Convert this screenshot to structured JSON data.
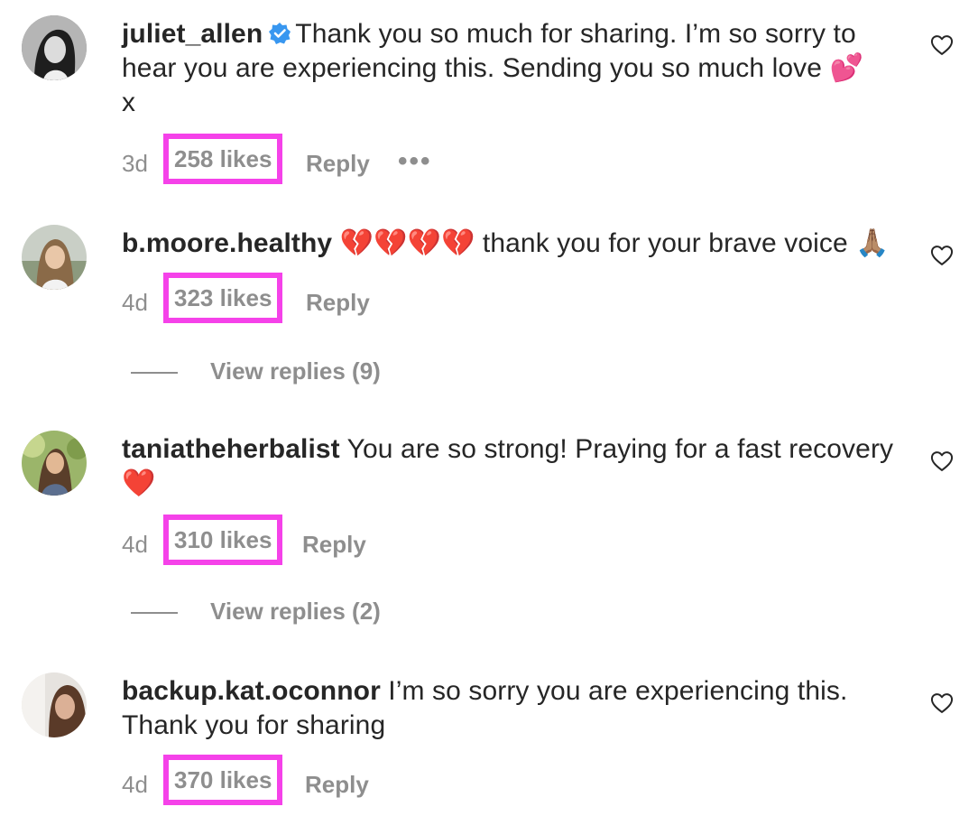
{
  "comments": [
    {
      "username": "juliet_allen",
      "verified": true,
      "text": "Thank you so much for sharing. I’m so sorry to hear you are experiencing this. Sending you so much love",
      "emoji": "💕",
      "text_tail": "x",
      "time": "3d",
      "likes": "258 likes",
      "reply": "Reply",
      "more": "•••"
    },
    {
      "username": "b.moore.healthy",
      "verified": false,
      "emoji_prefix": "💔💔💔💔",
      "text": "thank you for your brave voice",
      "emoji": "🙏🏽",
      "time": "4d",
      "likes": "323 likes",
      "reply": "Reply",
      "view_replies": "View replies (9)"
    },
    {
      "username": "taniatheherbalist",
      "verified": false,
      "text": "You are so strong! Praying for a fast recovery",
      "emoji": "❤️",
      "time": "4d",
      "likes": "310 likes",
      "reply": "Reply",
      "view_replies": "View replies (2)"
    },
    {
      "username": "backup.kat.oconnor",
      "verified": false,
      "text": "I’m so sorry you are experiencing this. Thank you for sharing",
      "time": "4d",
      "likes": "370 likes",
      "reply": "Reply"
    }
  ],
  "icons": {
    "like": "heart-outline-icon",
    "verified": "verified-badge-icon"
  },
  "colors": {
    "highlight": "#f542e9",
    "meta_text": "#8e8e8e",
    "primary_text": "#262626",
    "verified": "#3897f0"
  }
}
